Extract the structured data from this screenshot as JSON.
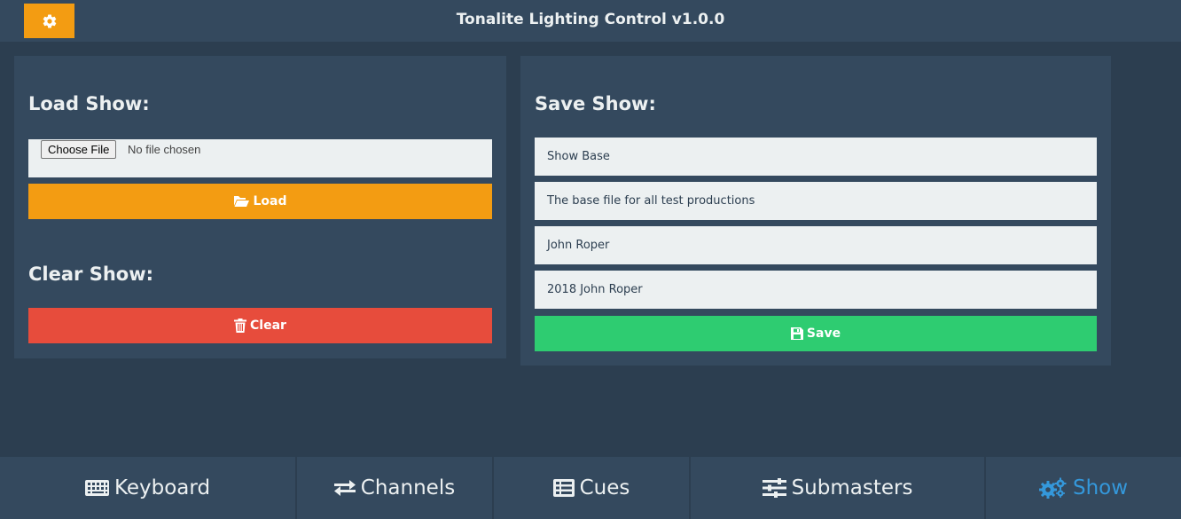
{
  "header": {
    "title": "Tonalite Lighting Control v1.0.0",
    "settings_icon": "gear-icon"
  },
  "load_section": {
    "heading": "Load Show:",
    "choose_file_label": "Choose File",
    "file_status": "No file chosen",
    "load_label": "Load"
  },
  "clear_section": {
    "heading": "Clear Show:",
    "clear_label": "Clear"
  },
  "save_section": {
    "heading": "Save Show:",
    "fields": [
      "Show Base",
      "The base file for all test productions",
      "John Roper",
      "2018 John Roper"
    ],
    "save_label": "Save"
  },
  "nav": {
    "tabs": [
      {
        "label": "Keyboard",
        "icon": "keyboard-icon"
      },
      {
        "label": "Channels",
        "icon": "exchange-icon"
      },
      {
        "label": "Cues",
        "icon": "list-icon"
      },
      {
        "label": "Submasters",
        "icon": "sliders-icon"
      },
      {
        "label": "Show",
        "icon": "cogs-icon"
      }
    ],
    "active": "Show"
  },
  "colors": {
    "background": "#2c3e50",
    "panel": "#34495e",
    "accent_orange": "#f39c12",
    "danger_red": "#e74c3c",
    "success_green": "#2ecc71",
    "active_blue": "#3498db"
  }
}
